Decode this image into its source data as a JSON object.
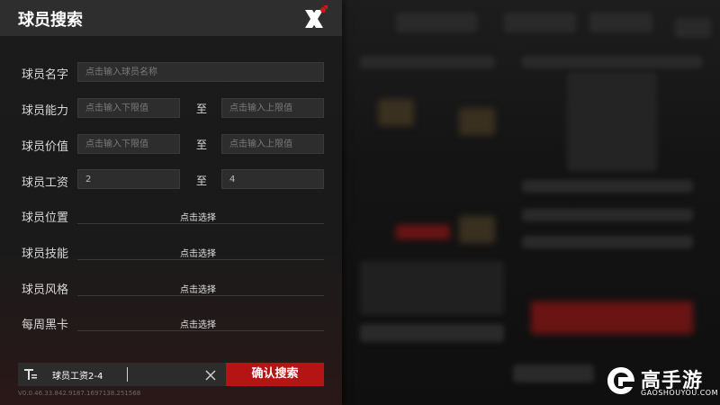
{
  "panel": {
    "title": "球员搜索",
    "fields": {
      "name": {
        "label": "球员名字",
        "placeholder": "点击输入球员名称"
      },
      "ability": {
        "label": "球员能力",
        "min_placeholder": "点击输入下限值",
        "max_placeholder": "点击输入上限值"
      },
      "value": {
        "label": "球员价值",
        "min_placeholder": "点击输入下限值",
        "max_placeholder": "点击输入上限值"
      },
      "salary": {
        "label": "球员工资",
        "min_value": "2",
        "max_value": "4"
      }
    },
    "range_sep": "至",
    "selects": [
      {
        "label": "球员位置",
        "value": "点击选择"
      },
      {
        "label": "球员技能",
        "value": "点击选择"
      },
      {
        "label": "球员风格",
        "value": "点击选择"
      },
      {
        "label": "每周黑卡",
        "value": "点击选择"
      }
    ],
    "query_text": "球员工资2-4",
    "confirm_label": "确认搜索",
    "version": "V0.0.46.33.842.9187.1697138.251568"
  },
  "watermark": {
    "cn": "高手游",
    "en": "GAOSHOUYOU.COM"
  },
  "colors": {
    "accent": "#b51414",
    "panel_bg": "#1b1b1b",
    "titlebar_bg": "#2e2e2e"
  },
  "icons": {
    "close": "close-x-icon",
    "filter": "filter-icon",
    "clear": "clear-x-icon",
    "logo": "gaoshouyou-logo-icon"
  }
}
